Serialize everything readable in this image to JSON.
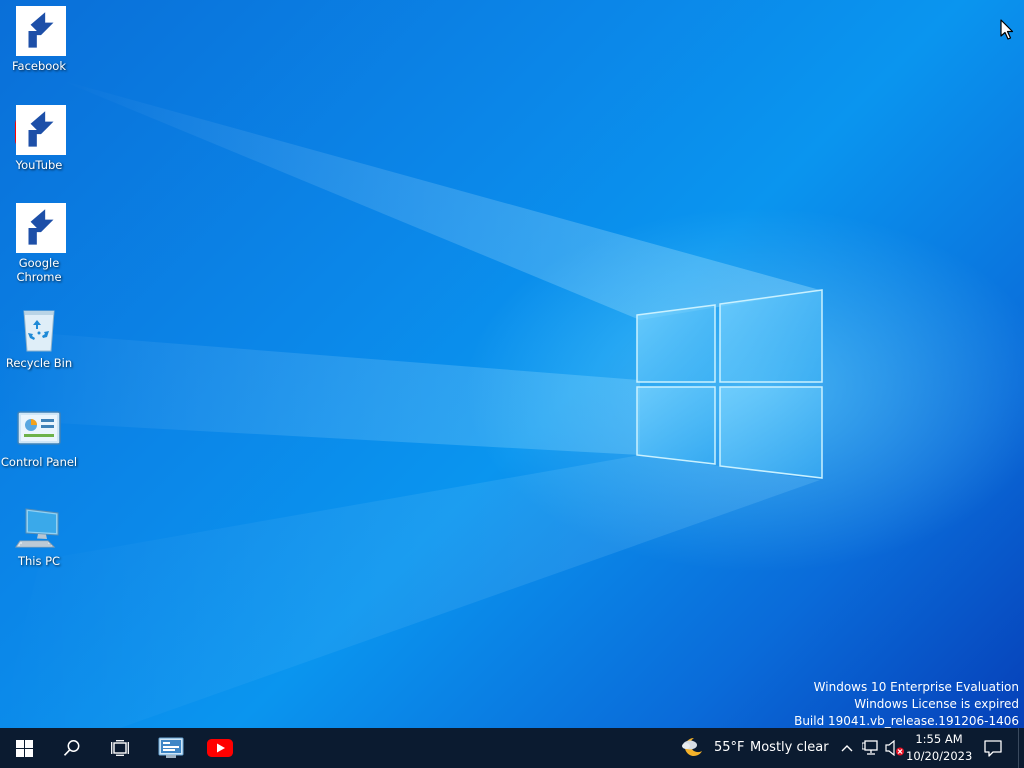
{
  "desktop": {
    "icons": [
      {
        "label": "Facebook"
      },
      {
        "label": "YouTube"
      },
      {
        "label": "Google Chrome"
      },
      {
        "label": "Recycle Bin"
      },
      {
        "label": "Control Panel"
      },
      {
        "label": "This PC"
      }
    ],
    "watermark": {
      "line1": "Windows 10 Enterprise Evaluation",
      "line2": "Windows License is expired",
      "line3": "Build 19041.vb_release.191206-1406"
    }
  },
  "taskbar": {
    "start_icon": "windows-logo-icon",
    "search_icon": "search-icon",
    "taskview_icon": "task-view-icon",
    "pinned": [
      "control-panel-app-icon",
      "youtube-app-icon"
    ],
    "weather": {
      "temperature": "55°F",
      "condition": "Mostly clear",
      "icon": "moon-cloud-icon"
    },
    "tray": {
      "chevron_icon": "chevron-up-icon",
      "network_icon": "network-icon",
      "volume_icon": "volume-muted-icon"
    },
    "clock": {
      "time": "1:55 AM",
      "date": "10/20/2023"
    },
    "notification_icon": "action-center-icon"
  },
  "colors": {
    "taskbar_bg": "#0b1b30",
    "desktop_blue": "#0a86e8",
    "youtube_red": "#ff0000",
    "facebook_blue": "#1877f2"
  }
}
